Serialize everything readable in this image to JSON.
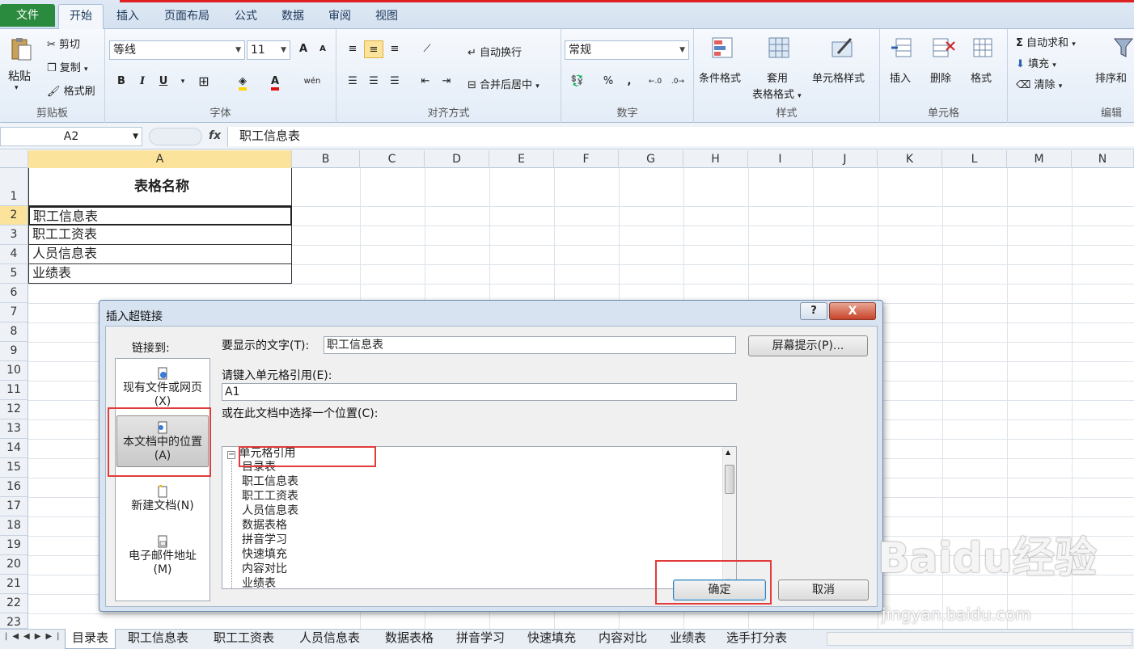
{
  "ribbon": {
    "tabs": [
      "文件",
      "开始",
      "插入",
      "页面布局",
      "公式",
      "数据",
      "审阅",
      "视图"
    ],
    "clipboard": {
      "title": "剪贴板",
      "paste": "粘贴",
      "cut": "剪切",
      "copy": "复制",
      "format_painter": "格式刷"
    },
    "font": {
      "title": "字体",
      "font_name": "等线",
      "font_size": "11",
      "bold": "B",
      "italic": "I",
      "underline": "U",
      "grow": "A",
      "shrink": "A",
      "wen": "wén"
    },
    "alignment": {
      "title": "对齐方式",
      "wrap": "自动换行",
      "merge": "合并后居中"
    },
    "number": {
      "title": "数字",
      "format": "常规",
      "percent": "%",
      "comma": ","
    },
    "styles": {
      "title": "样式",
      "conditional": "条件格式",
      "table_line1": "套用",
      "table_line2": "表格格式",
      "cell_styles": "单元格样式"
    },
    "cells": {
      "title": "单元格",
      "insert": "插入",
      "delete": "删除",
      "format": "格式"
    },
    "editing": {
      "title": "编辑",
      "autosum": "自动求和",
      "fill": "填充",
      "clear": "清除",
      "sort": "排序和"
    }
  },
  "formula_bar": {
    "name_box": "A2",
    "fx": "fx",
    "content": "职工信息表"
  },
  "columns": [
    "A",
    "B",
    "C",
    "D",
    "E",
    "F",
    "G",
    "H",
    "I",
    "J",
    "K",
    "L",
    "M",
    "N"
  ],
  "rows": [
    "1",
    "2",
    "3",
    "4",
    "5",
    "6",
    "7",
    "8",
    "9",
    "10",
    "11",
    "12",
    "13",
    "14",
    "15",
    "16",
    "17",
    "18",
    "19",
    "20",
    "21",
    "22",
    "23"
  ],
  "cells": {
    "a1": "表格名称",
    "a2": "职工信息表",
    "a3": "职工工资表",
    "a4": "人员信息表",
    "a5": "业绩表"
  },
  "sheet_tabs": [
    "目录表",
    "职工信息表",
    "职工工资表",
    "人员信息表",
    "数据表格",
    "拼音学习",
    "快速填充",
    "内容对比",
    "业绩表",
    "选手打分表"
  ],
  "dialog": {
    "title": "插入超链接",
    "help": "?",
    "close": "X",
    "link_to": "链接到:",
    "link_items": [
      {
        "line1": "现有文件或网页",
        "line2": "(X)"
      },
      {
        "line1": "本文档中的位置",
        "line2": "(A)"
      },
      {
        "line1": "新建文档(N)",
        "line2": ""
      },
      {
        "line1": "电子邮件地址",
        "line2": "(M)"
      }
    ],
    "display_text_label": "要显示的文字(T):",
    "display_text_value": "职工信息表",
    "screentip_button": "屏幕提示(P)...",
    "cell_ref_label": "请键入单元格引用(E):",
    "cell_ref_value": "A1",
    "place_label": "或在此文档中选择一个位置(C):",
    "tree_root": "单元格引用",
    "tree_items": [
      "目录表",
      "职工信息表",
      "职工工资表",
      "人员信息表",
      "数据表格",
      "拼音学习",
      "快速填充",
      "内容对比",
      "业绩表"
    ],
    "ok": "确定",
    "cancel": "取消"
  },
  "watermark": {
    "brand": "Baidu经验",
    "url": "jingyan.baidu.com"
  },
  "colors": {
    "file_tab": "#2a8a3e",
    "highlight": "#e23b3b",
    "ribbon": "#e3ecf7"
  }
}
